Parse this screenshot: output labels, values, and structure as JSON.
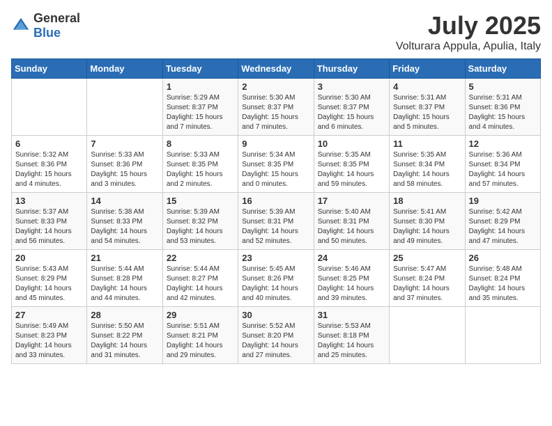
{
  "logo": {
    "general": "General",
    "blue": "Blue"
  },
  "header": {
    "month": "July 2025",
    "location": "Volturara Appula, Apulia, Italy"
  },
  "weekdays": [
    "Sunday",
    "Monday",
    "Tuesday",
    "Wednesday",
    "Thursday",
    "Friday",
    "Saturday"
  ],
  "weeks": [
    [
      {
        "day": "",
        "info": ""
      },
      {
        "day": "",
        "info": ""
      },
      {
        "day": "1",
        "info": "Sunrise: 5:29 AM\nSunset: 8:37 PM\nDaylight: 15 hours and 7 minutes."
      },
      {
        "day": "2",
        "info": "Sunrise: 5:30 AM\nSunset: 8:37 PM\nDaylight: 15 hours and 7 minutes."
      },
      {
        "day": "3",
        "info": "Sunrise: 5:30 AM\nSunset: 8:37 PM\nDaylight: 15 hours and 6 minutes."
      },
      {
        "day": "4",
        "info": "Sunrise: 5:31 AM\nSunset: 8:37 PM\nDaylight: 15 hours and 5 minutes."
      },
      {
        "day": "5",
        "info": "Sunrise: 5:31 AM\nSunset: 8:36 PM\nDaylight: 15 hours and 4 minutes."
      }
    ],
    [
      {
        "day": "6",
        "info": "Sunrise: 5:32 AM\nSunset: 8:36 PM\nDaylight: 15 hours and 4 minutes."
      },
      {
        "day": "7",
        "info": "Sunrise: 5:33 AM\nSunset: 8:36 PM\nDaylight: 15 hours and 3 minutes."
      },
      {
        "day": "8",
        "info": "Sunrise: 5:33 AM\nSunset: 8:35 PM\nDaylight: 15 hours and 2 minutes."
      },
      {
        "day": "9",
        "info": "Sunrise: 5:34 AM\nSunset: 8:35 PM\nDaylight: 15 hours and 0 minutes."
      },
      {
        "day": "10",
        "info": "Sunrise: 5:35 AM\nSunset: 8:35 PM\nDaylight: 14 hours and 59 minutes."
      },
      {
        "day": "11",
        "info": "Sunrise: 5:35 AM\nSunset: 8:34 PM\nDaylight: 14 hours and 58 minutes."
      },
      {
        "day": "12",
        "info": "Sunrise: 5:36 AM\nSunset: 8:34 PM\nDaylight: 14 hours and 57 minutes."
      }
    ],
    [
      {
        "day": "13",
        "info": "Sunrise: 5:37 AM\nSunset: 8:33 PM\nDaylight: 14 hours and 56 minutes."
      },
      {
        "day": "14",
        "info": "Sunrise: 5:38 AM\nSunset: 8:33 PM\nDaylight: 14 hours and 54 minutes."
      },
      {
        "day": "15",
        "info": "Sunrise: 5:39 AM\nSunset: 8:32 PM\nDaylight: 14 hours and 53 minutes."
      },
      {
        "day": "16",
        "info": "Sunrise: 5:39 AM\nSunset: 8:31 PM\nDaylight: 14 hours and 52 minutes."
      },
      {
        "day": "17",
        "info": "Sunrise: 5:40 AM\nSunset: 8:31 PM\nDaylight: 14 hours and 50 minutes."
      },
      {
        "day": "18",
        "info": "Sunrise: 5:41 AM\nSunset: 8:30 PM\nDaylight: 14 hours and 49 minutes."
      },
      {
        "day": "19",
        "info": "Sunrise: 5:42 AM\nSunset: 8:29 PM\nDaylight: 14 hours and 47 minutes."
      }
    ],
    [
      {
        "day": "20",
        "info": "Sunrise: 5:43 AM\nSunset: 8:29 PM\nDaylight: 14 hours and 45 minutes."
      },
      {
        "day": "21",
        "info": "Sunrise: 5:44 AM\nSunset: 8:28 PM\nDaylight: 14 hours and 44 minutes."
      },
      {
        "day": "22",
        "info": "Sunrise: 5:44 AM\nSunset: 8:27 PM\nDaylight: 14 hours and 42 minutes."
      },
      {
        "day": "23",
        "info": "Sunrise: 5:45 AM\nSunset: 8:26 PM\nDaylight: 14 hours and 40 minutes."
      },
      {
        "day": "24",
        "info": "Sunrise: 5:46 AM\nSunset: 8:25 PM\nDaylight: 14 hours and 39 minutes."
      },
      {
        "day": "25",
        "info": "Sunrise: 5:47 AM\nSunset: 8:24 PM\nDaylight: 14 hours and 37 minutes."
      },
      {
        "day": "26",
        "info": "Sunrise: 5:48 AM\nSunset: 8:24 PM\nDaylight: 14 hours and 35 minutes."
      }
    ],
    [
      {
        "day": "27",
        "info": "Sunrise: 5:49 AM\nSunset: 8:23 PM\nDaylight: 14 hours and 33 minutes."
      },
      {
        "day": "28",
        "info": "Sunrise: 5:50 AM\nSunset: 8:22 PM\nDaylight: 14 hours and 31 minutes."
      },
      {
        "day": "29",
        "info": "Sunrise: 5:51 AM\nSunset: 8:21 PM\nDaylight: 14 hours and 29 minutes."
      },
      {
        "day": "30",
        "info": "Sunrise: 5:52 AM\nSunset: 8:20 PM\nDaylight: 14 hours and 27 minutes."
      },
      {
        "day": "31",
        "info": "Sunrise: 5:53 AM\nSunset: 8:18 PM\nDaylight: 14 hours and 25 minutes."
      },
      {
        "day": "",
        "info": ""
      },
      {
        "day": "",
        "info": ""
      }
    ]
  ]
}
